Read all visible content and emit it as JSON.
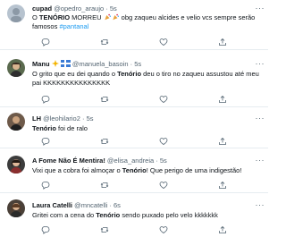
{
  "tweets": [
    {
      "name": "cupad",
      "handle": "@opedro_araujo",
      "time": "· 5s",
      "text_pre": "O ",
      "text_hl": "TENÓRIO",
      "text_post": " MORREU ",
      "text_tail": " obg zaqueu alcides e velio vcs sempre serão famosos ",
      "hashtag": "#pantanal",
      "avatar_color": "#b7c3cf"
    },
    {
      "name": "Manu",
      "handle": "@manuela_basoin",
      "time": "· 5s",
      "text_pre": "O grito que eu dei quando o ",
      "text_hl": "Tenório",
      "text_post": " deu o tiro no zaqueu assustou até meu pai KKKKKKKKKKKKKKK",
      "avatar_color": "#5a6a4e"
    },
    {
      "name": "LH",
      "handle": "@leohilario2",
      "time": "· 5s",
      "text_pre": "",
      "text_hl": "Tenório",
      "text_post": " foi de ralo",
      "avatar_color": "#6e5a4a"
    },
    {
      "name": "A Fome Não É Mentira!",
      "handle": "@elisa_andreia",
      "time": "· 5s",
      "text_pre": "Vixi que a cobra foi almoçar o ",
      "text_hl": "Tenório",
      "text_post": "! Que perigo de uma indigestão!",
      "avatar_color": "#3c3c3c"
    },
    {
      "name": "Laura Catelli",
      "handle": "@mncatelli",
      "time": "· 6s",
      "text_pre": "Gritei com a cena do ",
      "text_hl": "Tenório",
      "text_post": " sendo puxado pelo velo kkkkkkk",
      "avatar_color": "#4a4038"
    }
  ],
  "icons": {
    "reply": "reply-icon",
    "retweet": "retweet-icon",
    "like": "like-icon",
    "share": "share-icon",
    "more": "more-icon"
  },
  "colors": {
    "link": "#1d9bf0",
    "meta": "#536471",
    "divider": "#e6ecf0"
  }
}
